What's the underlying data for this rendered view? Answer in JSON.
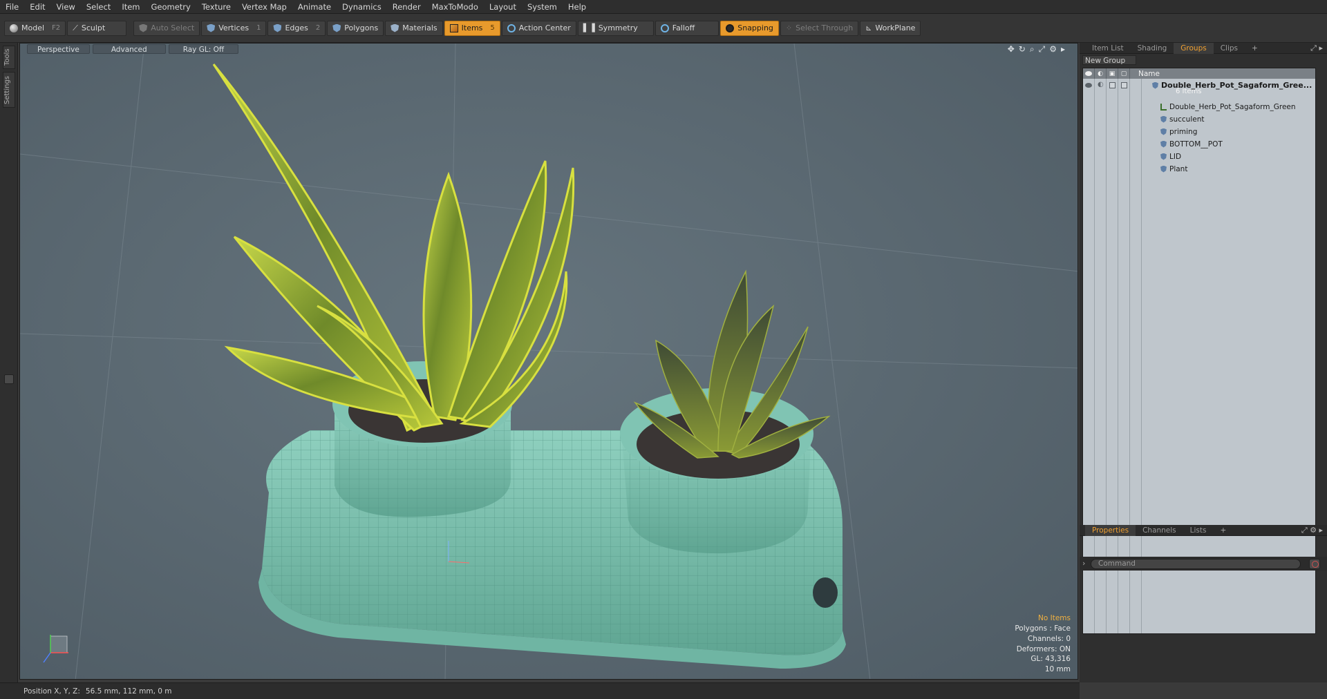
{
  "menu": [
    "File",
    "Edit",
    "View",
    "Select",
    "Item",
    "Geometry",
    "Texture",
    "Vertex Map",
    "Animate",
    "Dynamics",
    "Render",
    "MaxToModo",
    "Layout",
    "System",
    "Help"
  ],
  "toolbar": {
    "model": "Model",
    "model_key": "F2",
    "sculpt": "Sculpt",
    "auto_select": "Auto Select",
    "vertices": "Vertices",
    "vertices_key": "1",
    "edges": "Edges",
    "edges_key": "2",
    "polygons": "Polygons",
    "materials": "Materials",
    "items": "Items",
    "items_key": "5",
    "action_center": "Action Center",
    "symmetry": "Symmetry",
    "falloff": "Falloff",
    "snapping": "Snapping",
    "select_through": "Select Through",
    "workplane": "WorkPlane"
  },
  "left_tabs": [
    "Tools",
    "Settings"
  ],
  "viewport": {
    "view": "Perspective",
    "mode": "Advanced",
    "raygl": "Ray GL: Off",
    "hud": {
      "items": "No Items",
      "polygons": "Polygons : Face",
      "channels": "Channels: 0",
      "deformers": "Deformers: ON",
      "gl": "GL: 43,316",
      "scale": "10 mm"
    }
  },
  "right_panel": {
    "tabs": [
      "Item List",
      "Shading",
      "Groups",
      "Clips",
      "+"
    ],
    "active_tab": "Groups",
    "new_group": "New Group",
    "name_header": "Name",
    "root": {
      "name": "Double_Herb_Pot_Sagaform_Gree...",
      "sub": "6 Items"
    },
    "items": [
      "Double_Herb_Pot_Sagaform_Green",
      "succulent",
      "priming",
      "BOTTOM__POT",
      "LID",
      "Plant"
    ],
    "bottom_tabs": [
      "Properties",
      "Channels",
      "Lists",
      "+"
    ],
    "command_placeholder": "Command"
  },
  "status": {
    "label": "Position X, Y, Z:",
    "value": "56.5 mm, 112 mm, 0 m"
  },
  "colors": {
    "accent": "#e89a2c",
    "viewport_bg": "#5c6a74",
    "pot": "#7fbfae"
  }
}
